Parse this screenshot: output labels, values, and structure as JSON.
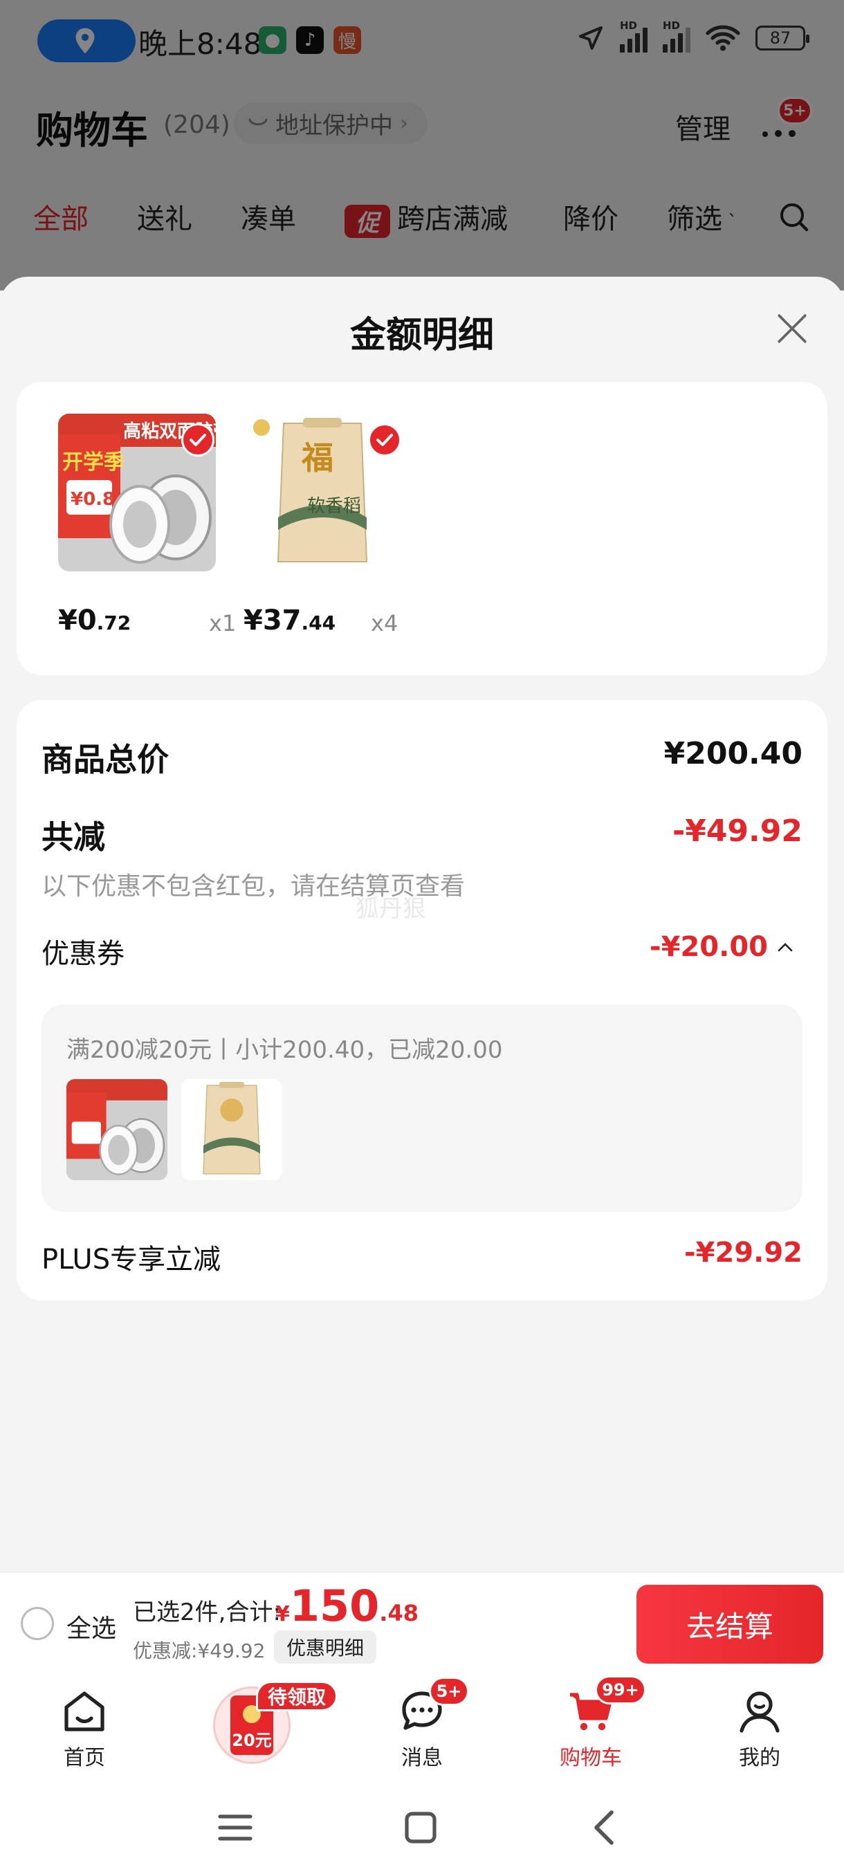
{
  "status_bar": {
    "time": "晚上8:48",
    "battery": "87",
    "signal_label": "HD"
  },
  "cart_header": {
    "title": "购物车",
    "count": "(204)",
    "address_protect": "地址保护中",
    "manage": "管理",
    "more_badge": "5+"
  },
  "cart_tabs": {
    "all": "全部",
    "gift": "送礼",
    "combine": "凑单",
    "promo_mark": "促",
    "cross_store": "跨店满减",
    "price_drop": "降价",
    "filter": "筛选"
  },
  "sheet": {
    "title": "金额明细",
    "products": [
      {
        "price_int": "¥0",
        "price_dec": ".72",
        "qty": "x1",
        "image_text_top": "高粘双面胶带",
        "image_text_badge": "开学季",
        "image_text_price": "¥0.8"
      },
      {
        "price_int": "¥37",
        "price_dec": ".44",
        "qty": "x4",
        "image_text_top": "福",
        "image_text_sub": "软香稻"
      }
    ],
    "total_label": "商品总价",
    "total_value": "¥200.40",
    "reduce_label": "共减",
    "reduce_value": "-¥49.92",
    "note": "以下优惠不包含红包，请在结算页查看",
    "watermark": "狐丹狠",
    "coupon_label": "优惠券",
    "coupon_value": "-¥20.00",
    "coupon_desc": "满200减20元丨小计200.40，已减20.00",
    "plus_label": "PLUS专享立减",
    "plus_value": "-¥29.92"
  },
  "checkout": {
    "select_all": "全选",
    "selected_summary": "已选2件,合计:",
    "currency": "¥",
    "total_int": "150",
    "total_dec": ".48",
    "discount_line": "优惠减:¥49.92",
    "detail_chip": "优惠明细",
    "button": "去结算"
  },
  "tabbar": {
    "home": "首页",
    "coupon_amount": "20元",
    "pending": "待领取",
    "messages": "消息",
    "messages_badge": "5+",
    "cart": "购物车",
    "cart_badge": "99+",
    "mine": "我的"
  },
  "colors": {
    "accent_red": "#e4262b",
    "location_blue": "#1a7cf5"
  }
}
